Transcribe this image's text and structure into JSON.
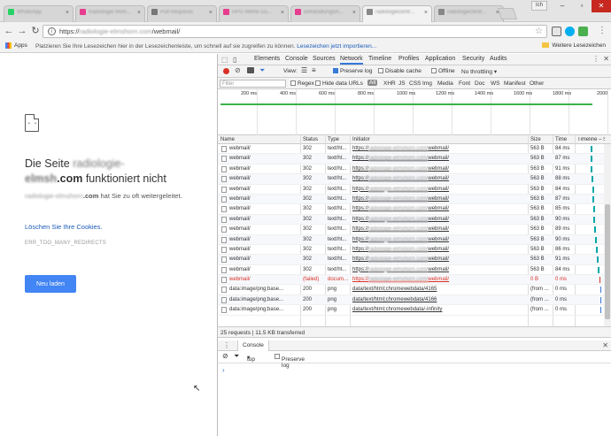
{
  "browser": {
    "tabs": [
      {
        "title": "WhatsApp",
        "favicon": "#25d366",
        "active": false
      },
      {
        "title": "Radiologie Ilmm...",
        "favicon": "#e63d8f",
        "active": false
      },
      {
        "title": "Pull Requests",
        "favicon": "#777777",
        "active": false
      },
      {
        "title": "HPG Werte Du...",
        "favicon": "#e63d8f",
        "active": false
      },
      {
        "title": "Behandlungsm...",
        "favicon": "#e63d8f",
        "active": false
      },
      {
        "title": "radiologiezentr...",
        "favicon": "#888888",
        "active": true
      },
      {
        "title": "radiologiezentr...",
        "favicon": "#888888",
        "active": false
      }
    ],
    "profile": "Ich",
    "url_prefix": "https://",
    "url_host": "radiologie-elmshorn.com",
    "url_path": "/webmail/",
    "bookmarks": {
      "apps_label": "Apps",
      "hint_text": "Platzieren Sie Ihre Lesezeichen hier in der Lesezeichenleiste, um schnell auf sie zugreifen zu können.",
      "hint_link": "Lesezeichen jetzt importieren...",
      "other_label": "Weitere Lesezeichen"
    }
  },
  "error_page": {
    "title_prefix": "Die Seite",
    "title_host_blur": "radiologie-",
    "title_host_bold": "elmsh",
    "title_host_bold2": ".com",
    "title_suffix": "funktioniert nicht",
    "desc_host_blur": "radiologie-elmshorn",
    "desc_host": ".com",
    "desc_rest": "hat Sie zu oft weitergeleitet.",
    "link_text": "Löschen Sie Ihre Cookies.",
    "error_code": "ERR_TOO_MANY_REDIRECTS",
    "reload_button": "Neu laden"
  },
  "devtools": {
    "tabs": [
      "Elements",
      "Console",
      "Sources",
      "Network",
      "Timeline",
      "Profiles",
      "Application",
      "Security",
      "Audits"
    ],
    "selected_tab": "Network",
    "toolbar": {
      "view_label": "View:",
      "preserve_log": "Preserve log",
      "disable_cache": "Disable cache",
      "offline": "Offline",
      "throttling": "No throttling"
    },
    "filter": {
      "placeholder": "Filter",
      "regex": "Regex",
      "hide_data_urls": "Hide data URLs",
      "types": [
        "All",
        "XHR",
        "JS",
        "CSS",
        "Img",
        "Media",
        "Font",
        "Doc",
        "WS",
        "Manifest",
        "Other"
      ]
    },
    "timeline_ticks": [
      "200 ms",
      "400 ms",
      "600 ms",
      "800 ms",
      "1000 ms",
      "1200 ms",
      "1400 ms",
      "1600 ms",
      "1800 ms",
      "2000"
    ],
    "columns": [
      "Name",
      "Status",
      "Type",
      "Initiator",
      "Size",
      "Time",
      "Timeline – Start Time"
    ],
    "rows": [
      {
        "name": "webmail/",
        "status": "302",
        "type": "text/ht...",
        "initiator_pre": "https://",
        "initiator_blur": "radiologie-elmshorn.com/",
        "initiator_post": "webmail/",
        "size": "563 B",
        "time": "84 ms",
        "wf": 0.55,
        "failed": false
      },
      {
        "name": "webmail/",
        "status": "302",
        "type": "text/ht...",
        "initiator_pre": "https://",
        "initiator_blur": "radiologie-elmshorn.com/",
        "initiator_post": "webmail/",
        "size": "563 B",
        "time": "87 ms",
        "wf": 0.56,
        "failed": false
      },
      {
        "name": "webmail/",
        "status": "302",
        "type": "text/ht...",
        "initiator_pre": "https://",
        "initiator_blur": "radiologie-elmshorn.com/",
        "initiator_post": "webmail/",
        "size": "563 B",
        "time": "91 ms",
        "wf": 0.58,
        "failed": false
      },
      {
        "name": "webmail/",
        "status": "302",
        "type": "text/ht...",
        "initiator_pre": "https://",
        "initiator_blur": "radiologie-elmshorn.com/",
        "initiator_post": "webmail/",
        "size": "563 B",
        "time": "88 ms",
        "wf": 0.6,
        "failed": false
      },
      {
        "name": "webmail/",
        "status": "302",
        "type": "text/ht...",
        "initiator_pre": "https://",
        "initiator_blur": "radiologie-elmshorn.com/",
        "initiator_post": "webmail/",
        "size": "563 B",
        "time": "84 ms",
        "wf": 0.62,
        "failed": false
      },
      {
        "name": "webmail/",
        "status": "302",
        "type": "text/ht...",
        "initiator_pre": "https://",
        "initiator_blur": "radiologie-elmshorn.com/",
        "initiator_post": "webmail/",
        "size": "563 B",
        "time": "87 ms",
        "wf": 0.64,
        "failed": false
      },
      {
        "name": "webmail/",
        "status": "302",
        "type": "text/ht...",
        "initiator_pre": "https://",
        "initiator_blur": "radiologie-elmshorn.com/",
        "initiator_post": "webmail/",
        "size": "563 B",
        "time": "85 ms",
        "wf": 0.66,
        "failed": false
      },
      {
        "name": "webmail/",
        "status": "302",
        "type": "text/ht...",
        "initiator_pre": "https://",
        "initiator_blur": "radiologie-elmshorn.com/",
        "initiator_post": "webmail/",
        "size": "563 B",
        "time": "90 ms",
        "wf": 0.68,
        "failed": false
      },
      {
        "name": "webmail/",
        "status": "302",
        "type": "text/ht...",
        "initiator_pre": "https://",
        "initiator_blur": "radiologie-elmshorn.com/",
        "initiator_post": "webmail/",
        "size": "563 B",
        "time": "89 ms",
        "wf": 0.7,
        "failed": false
      },
      {
        "name": "webmail/",
        "status": "302",
        "type": "text/ht...",
        "initiator_pre": "https://",
        "initiator_blur": "radiologie-elmshorn.com/",
        "initiator_post": "webmail/",
        "size": "563 B",
        "time": "90 ms",
        "wf": 0.73,
        "failed": false
      },
      {
        "name": "webmail/",
        "status": "302",
        "type": "text/ht...",
        "initiator_pre": "https://",
        "initiator_blur": "radiologie-elmshorn.com/",
        "initiator_post": "webmail/",
        "size": "563 B",
        "time": "86 ms",
        "wf": 0.76,
        "failed": false
      },
      {
        "name": "webmail/",
        "status": "302",
        "type": "text/ht...",
        "initiator_pre": "https://",
        "initiator_blur": "radiologie-elmshorn.com/",
        "initiator_post": "webmail/",
        "size": "563 B",
        "time": "91 ms",
        "wf": 0.79,
        "failed": false
      },
      {
        "name": "webmail/",
        "status": "302",
        "type": "text/ht...",
        "initiator_pre": "https://",
        "initiator_blur": "radiologie-elmshorn.com/",
        "initiator_post": "webmail/",
        "size": "563 B",
        "time": "84 ms",
        "wf": 0.82,
        "failed": false
      },
      {
        "name": "webmail/",
        "status": "(failed)",
        "type": "docum...",
        "initiator_pre": "https://",
        "initiator_blur": "radiologie-elmshorn.com/",
        "initiator_post": "webmail/",
        "size": "0 B",
        "time": "0 ms",
        "wf": 0.9,
        "failed": true
      },
      {
        "name": "data:image/png;base...",
        "status": "200",
        "type": "png",
        "initiator_pre": "data/text/html;chromewebdata/4165",
        "initiator_blur": "",
        "initiator_post": "",
        "size": "(from ...",
        "time": "0 ms",
        "wf": 0.92,
        "failed": false
      },
      {
        "name": "data:image/png;base...",
        "status": "200",
        "type": "png",
        "initiator_pre": "data/text/html;chromewebdata/4166",
        "initiator_blur": "",
        "initiator_post": "",
        "size": "(from ...",
        "time": "0 ms",
        "wf": 0.93,
        "failed": false
      },
      {
        "name": "data:image/png;base...",
        "status": "200",
        "type": "png",
        "initiator_pre": "data/text/html;chromewebdata/-Infinity",
        "initiator_blur": "",
        "initiator_post": "",
        "size": "(from ...",
        "time": "0 ms",
        "wf": 0.94,
        "failed": false
      }
    ],
    "summary": "25 requests  |  11.5 KB transferred",
    "drawer": {
      "tab": "Console",
      "context": "top",
      "preserve_log": "Preserve log",
      "prompt": "›"
    }
  }
}
